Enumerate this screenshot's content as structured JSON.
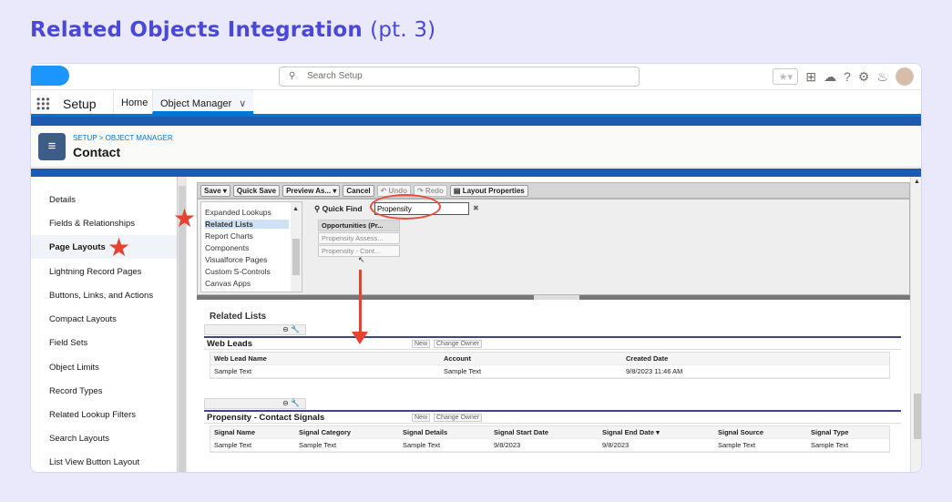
{
  "slide": {
    "title": "Related Objects Integration",
    "subtitle": "(pt. 3)"
  },
  "topbar": {
    "search_placeholder": "Search Setup"
  },
  "appnav": {
    "app_name": "Setup",
    "tabs": [
      "Home",
      "Object Manager"
    ]
  },
  "header": {
    "breadcrumb": "SETUP > OBJECT MANAGER",
    "object_name": "Contact"
  },
  "sidebar": {
    "items": [
      "Details",
      "Fields & Relationships",
      "Page Layouts",
      "Lightning Record Pages",
      "Buttons, Links, and Actions",
      "Compact Layouts",
      "Field Sets",
      "Object Limits",
      "Record Types",
      "Related Lookup Filters",
      "Search Layouts",
      "List View Button Layout"
    ],
    "active": "Page Layouts"
  },
  "toolbar": {
    "save": "Save ▾",
    "quick_save": "Quick Save",
    "preview": "Preview As... ▾",
    "cancel": "Cancel",
    "undo": "Undo",
    "redo": "Redo",
    "layout_properties": "Layout Properties"
  },
  "palette": {
    "categories": [
      "Expanded Lookups",
      "Related Lists",
      "Report Charts",
      "Components",
      "Visualforce Pages",
      "Custom S-Controls",
      "Canvas Apps"
    ],
    "selected": "Related Lists",
    "quick_find_label": "Quick Find",
    "quick_find_value": "Propensity",
    "items": [
      "Opportunities (Pr...",
      "Propensity Assess...",
      "Propensity - Cont..."
    ]
  },
  "related_lists": {
    "section_title": "Related Lists",
    "buttons": [
      "New",
      "Change Owner"
    ],
    "web_leads": {
      "name": "Web Leads",
      "columns": [
        "Web Lead Name",
        "Account",
        "Created Date"
      ],
      "row": [
        "Sample Text",
        "Sample Text",
        "9/8/2023 11:46 AM"
      ]
    },
    "signals": {
      "name": "Propensity - Contact Signals",
      "columns": [
        "Signal Name",
        "Signal Category",
        "Signal Details",
        "Signal Start Date",
        "Signal End Date ▾",
        "Signal Source",
        "Signal Type"
      ],
      "row": [
        "Sample Text",
        "Sample Text",
        "Sample Text",
        "9/8/2023",
        "9/8/2023",
        "Sample Text",
        "Sample Text"
      ]
    }
  },
  "colors": {
    "accent": "#4b48d8",
    "annotation": "#e8412f",
    "sf_blue": "#0176d3"
  }
}
